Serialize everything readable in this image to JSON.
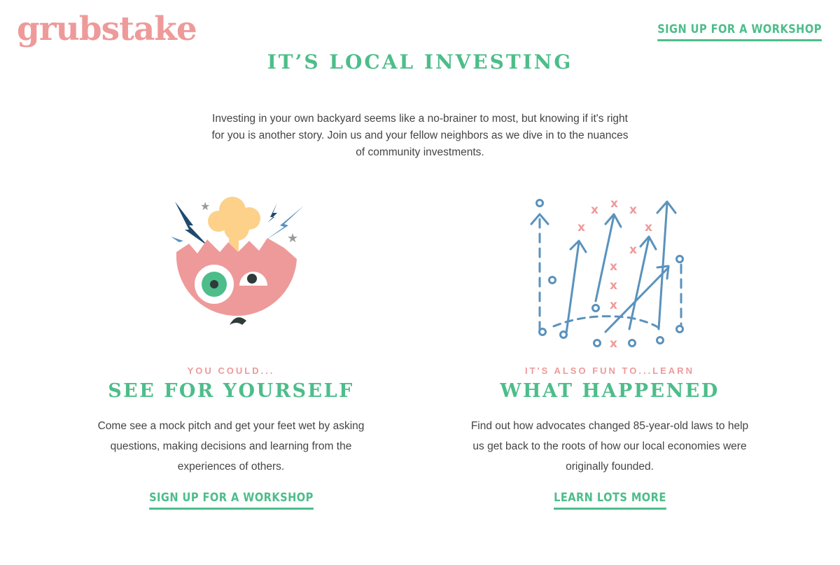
{
  "header": {
    "logo": "grubstake",
    "cta_label": "SIGN UP FOR A WORKSHOP"
  },
  "hero": {
    "title": "IT’S LOCAL INVESTING",
    "intro": "Investing in your own backyard seems like a no-brainer to most, but knowing if it's right for you is another story. Join us and your fellow neighbors as we dive in to the nuances of community investments."
  },
  "features": [
    {
      "kicker": "YOU COULD...",
      "title": "SEE FOR YOURSELF",
      "text": "Come see a mock pitch and get your feet wet by asking questions, making decisions and learning from the experiences of others.",
      "link_label": "SIGN UP FOR A WORKSHOP",
      "icon": "mind-blown-face-icon"
    },
    {
      "kicker": "IT'S ALSO FUN TO...LEARN",
      "title": "WHAT HAPPENED",
      "text": "Find out how advocates changed 85-year-old laws to help us get back to the roots of how our local economies were originally founded.",
      "link_label": "LEARN LOTS MORE",
      "icon": "game-plan-diagram-icon"
    }
  ],
  "colors": {
    "brand_pink": "#ee9a9a",
    "accent_green": "#4dbd8a",
    "diagram_blue": "#5a92bd",
    "explosion_yellow": "#fdd18a",
    "bolt_navy": "#1f4a6e"
  }
}
